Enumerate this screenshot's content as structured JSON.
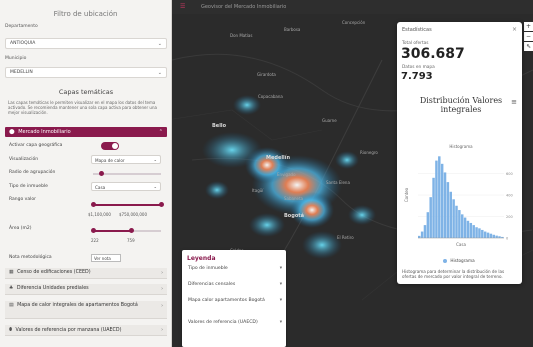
{
  "sidebar": {
    "title": "Filtro de ubicación",
    "departamento_label": "Departamento",
    "departamento_value": "ANTIOQUIA",
    "municipio_label": "Municipio",
    "municipio_value": "MEDELLIN",
    "capas_title": "Capas temáticas",
    "capas_note": "Las capas temáticas le permiten visualizar en el mapa los datos del tema activado. Se recomienda mantener una sola capa activa para obtener una mejor visualización.",
    "mercado_header": "Mercado Inmobiliario",
    "activar_label": "Activar capa geográfica",
    "visualizacion_label": "Visualización",
    "visualizacion_value": "Mapa de calor",
    "radio_label": "Radio de agrupación",
    "tipo_label": "Tipo de inmueble",
    "tipo_value": "Casa",
    "rango_label": "Rango valor",
    "rango_min": "$1,100,000",
    "rango_max": "$750,000,000",
    "area_label": "Área (m2)",
    "area_min": "222",
    "area_max": "759",
    "nota_label": "Nota metodológica",
    "nota_button": "Ver nota",
    "accordions": [
      {
        "icon": "building-icon",
        "label": "Censo de edificaciones (CEED)"
      },
      {
        "icon": "group-icon",
        "label": "Diferencia Unidades prediales"
      },
      {
        "icon": "map-icon",
        "label": "Mapa de calor integrales de apartamentos Bogotá"
      },
      {
        "icon": "pin-icon",
        "label": "Valores de referencia por manzana (UAECD)"
      }
    ]
  },
  "map": {
    "top_title": "Geovisor del Mercado Inmobiliario",
    "places": [
      "Barbosa",
      "Don Matías",
      "Girardota",
      "Copacabana",
      "Bello",
      "Medellín",
      "Envigado",
      "Itagüí",
      "Sabaneta",
      "Rionegro",
      "Guarne",
      "Santa Elena",
      "El Retiro",
      "Caldas",
      "Bogotá",
      "Concepción"
    ]
  },
  "stats": {
    "header": "Estadísticas",
    "total_label": "Total ofertas",
    "total_value": "306.687",
    "map_label": "Datos en mapa",
    "map_value": "7.793",
    "dist_title": "Distribución Valores integrales",
    "chart_legend": "Histograma",
    "description": "Histograma para determinar la distribución de las ofertas de mercado por valor integral de terreno."
  },
  "chart_data": {
    "type": "bar",
    "title": "Histograma",
    "xlabel": "Casa",
    "ylabel": "Conteo",
    "ylim": [
      0,
      800
    ],
    "yticks": [
      0,
      200,
      400,
      600
    ],
    "values": [
      20,
      60,
      120,
      240,
      380,
      560,
      720,
      760,
      690,
      610,
      520,
      430,
      360,
      300,
      260,
      220,
      190,
      160,
      140,
      120,
      100,
      90,
      75,
      60,
      50,
      40,
      30,
      22,
      16,
      10
    ],
    "color": "#7fb3e6"
  },
  "legend": {
    "title": "Leyenda",
    "items": [
      "Tipo de inmueble",
      "Diferencias censales",
      "Mapa calor apartamentos Bogotá",
      "Valores de referencia (UAECD)"
    ]
  },
  "colors": {
    "accent": "#8a1a4d",
    "histogram": "#7fb3e6"
  }
}
